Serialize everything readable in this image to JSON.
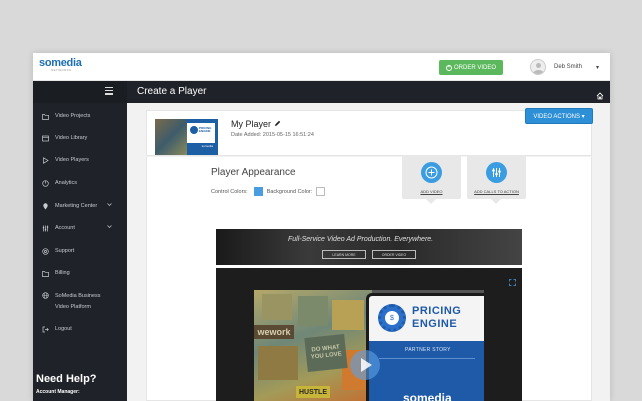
{
  "brand": {
    "logo_text": "somedia",
    "logo_sub": "NETWORKS",
    "logo_tag": "advertising",
    "accent_color": "#2d8fd6",
    "green_color": "#5cb85c"
  },
  "topbar": {
    "order_button": "ORDER VIDEO",
    "user_name": "Deb Smith",
    "caret": "▾"
  },
  "sidebar": {
    "items": [
      {
        "label": "Video Projects",
        "icon": "folder-icon"
      },
      {
        "label": "Video Library",
        "icon": "library-icon"
      },
      {
        "label": "Video Players",
        "icon": "play-icon"
      },
      {
        "label": "Analytics",
        "icon": "analytics-icon"
      },
      {
        "label": "Marketing Center",
        "icon": "map-pin-icon"
      },
      {
        "label": "Account",
        "icon": "sliders-icon"
      },
      {
        "label": "Support",
        "icon": "support-icon"
      },
      {
        "label": "Billing",
        "icon": "folder-icon"
      },
      {
        "label": "SoMedia Business Video Platform",
        "icon": "globe-icon"
      },
      {
        "label": "Logout",
        "icon": "logout-icon"
      }
    ],
    "help_title": "Need Help?",
    "account_manager": "Account Manager:"
  },
  "header": {
    "title": "Create a Player"
  },
  "player": {
    "name": "My Player",
    "date_added": "Date Added: 2015-05-15 16:51:24",
    "actions_button": "VIDEO ACTIONS ▾",
    "thumb_title": "PRICING ENGINE",
    "thumb_brand": "somedia"
  },
  "appearance": {
    "title": "Player Appearance",
    "control_colors_label": "Control Colors:",
    "background_color_label": "Background Color:",
    "control_color": "#4a9de0",
    "background_color": "#ffffff",
    "add_video_label": "ADD VIDEO",
    "add_calls_label": "ADD CALLS TO ACTION"
  },
  "banner": {
    "text": "Full-Service Video Ad Production. Everywhere.",
    "learn_more": "LEARN MORE",
    "order_video": "ORDER VIDEO"
  },
  "video": {
    "brand_wall": "wework",
    "what_text": "DO WHAT YOU LOVE",
    "hustle": "HUSTLE",
    "pricing1": "PRICING",
    "pricing2": "ENGINE",
    "partner_story": "PARTNER STORY",
    "somedia": "somedia"
  }
}
